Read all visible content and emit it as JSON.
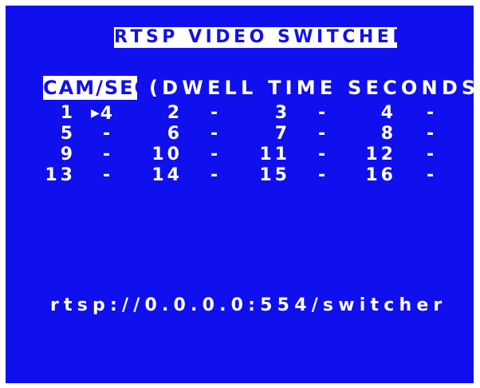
{
  "title": "RTSP VIDEO SWITCHER",
  "header": {
    "cam_sec": "CAM/SEC",
    "dwell_label": "(DWELL TIME SECONDS)"
  },
  "grid": [
    [
      {
        "cam": "1",
        "dwell": "4",
        "selected": true
      },
      {
        "cam": "2",
        "dwell": "-"
      },
      {
        "cam": "3",
        "dwell": "-"
      },
      {
        "cam": "4",
        "dwell": "-"
      }
    ],
    [
      {
        "cam": "5",
        "dwell": "-"
      },
      {
        "cam": "6",
        "dwell": "-"
      },
      {
        "cam": "7",
        "dwell": "-"
      },
      {
        "cam": "8",
        "dwell": "-"
      }
    ],
    [
      {
        "cam": "9",
        "dwell": "-"
      },
      {
        "cam": "10",
        "dwell": "-"
      },
      {
        "cam": "11",
        "dwell": "-"
      },
      {
        "cam": "12",
        "dwell": "-"
      }
    ],
    [
      {
        "cam": "13",
        "dwell": "-"
      },
      {
        "cam": "14",
        "dwell": "-"
      },
      {
        "cam": "15",
        "dwell": "-"
      },
      {
        "cam": "16",
        "dwell": "-"
      }
    ]
  ],
  "cursor_icon": "right-triangle-cursor",
  "url": "rtsp://0.0.0.0:554/switcher",
  "colors": {
    "background": "#1010ee",
    "text": "#ffffff",
    "border": "#ffffff"
  }
}
